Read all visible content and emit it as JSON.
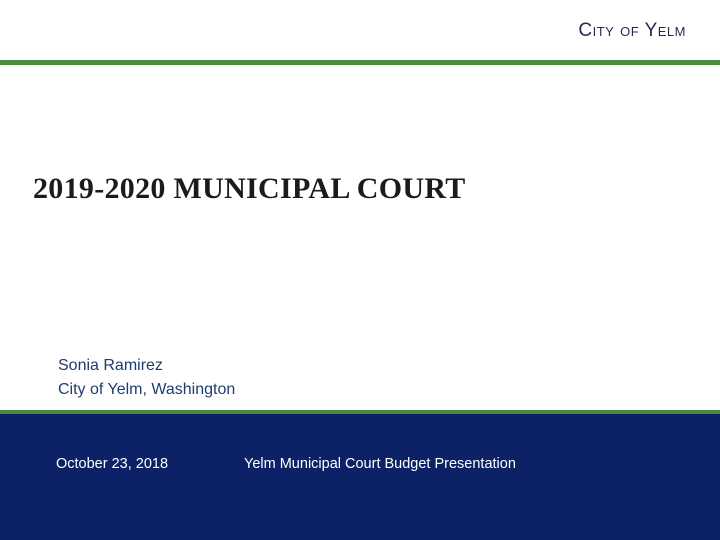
{
  "header": {
    "org_name": "City of Yelm"
  },
  "slide": {
    "title": "2019-2020 MUNICIPAL COURT",
    "presenter_name": "Sonia Ramirez",
    "presenter_affiliation": "City of Yelm, Washington"
  },
  "footer": {
    "date": "October 23, 2018",
    "caption": "Yelm Municipal Court Budget Presentation"
  },
  "colors": {
    "accent_green": "#4a8c3c",
    "footer_navy": "#0d2266",
    "header_text": "#1f2a55",
    "presenter_text": "#1f3c6e"
  }
}
